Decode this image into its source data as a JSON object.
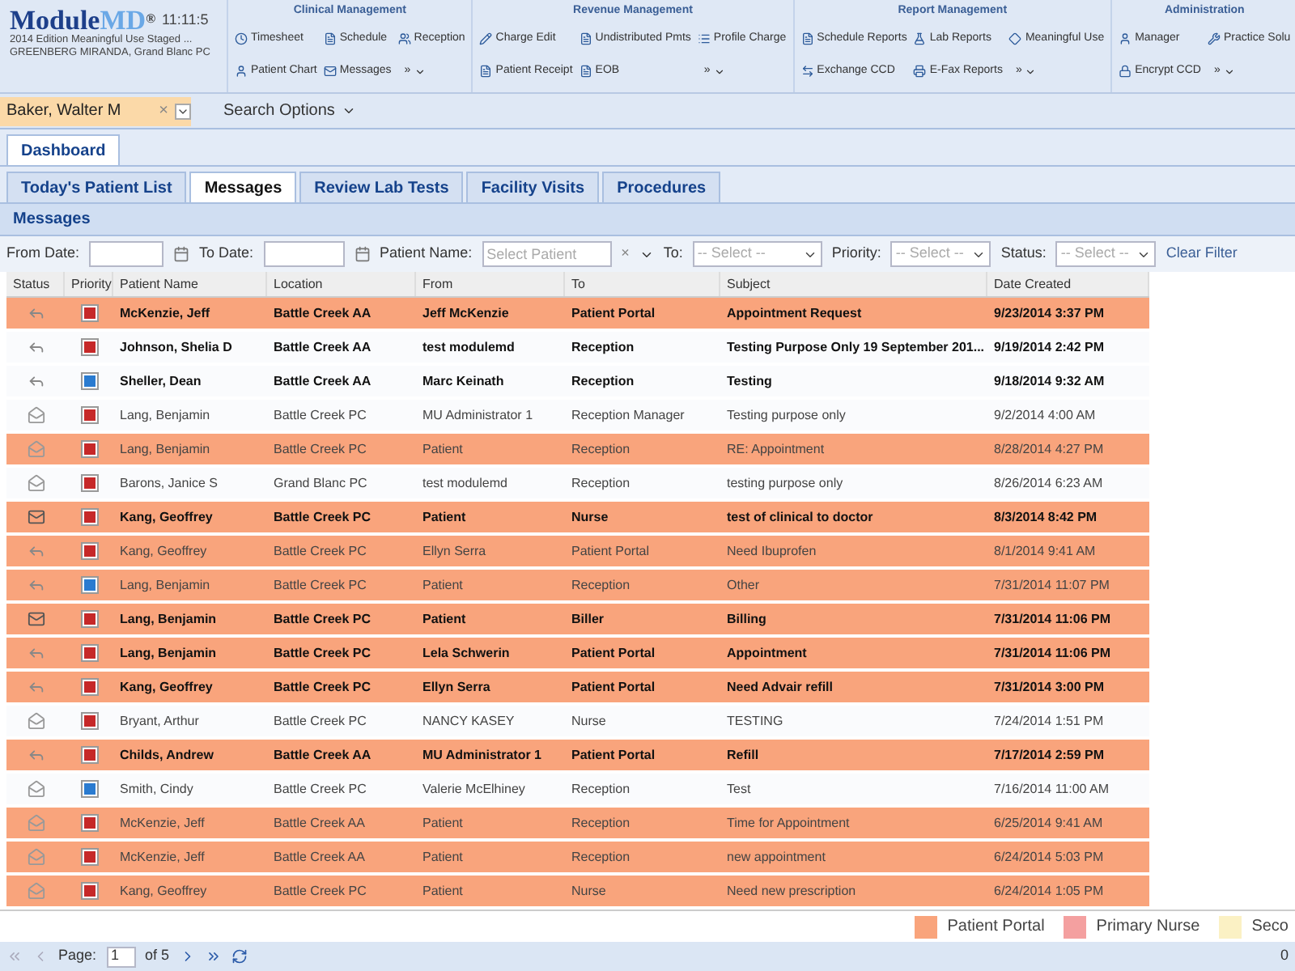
{
  "header": {
    "logo": "Module",
    "logo_accent": "MD",
    "logo_mark": "®",
    "time": "11:11:5",
    "edition": "2014 Edition Meaningful Use Staged ...",
    "user": "GREENBERG MIRANDA, Grand Blanc PC"
  },
  "ribbon": [
    {
      "title": "Clinical Management",
      "items": [
        {
          "label": "Timesheet",
          "kind": "clock"
        },
        {
          "label": "Schedule",
          "kind": "doc"
        },
        {
          "label": "Reception",
          "kind": "users"
        },
        {
          "label": "Patient Chart",
          "kind": "user"
        },
        {
          "label": "Messages",
          "kind": "mail"
        },
        {
          "label": "»",
          "kind": "more"
        }
      ]
    },
    {
      "title": "Revenue Management",
      "items": [
        {
          "label": "Charge Edit",
          "kind": "edit"
        },
        {
          "label": "Undistributed Pmts",
          "kind": "doc"
        },
        {
          "label": "Profile Charge",
          "kind": "list"
        },
        {
          "label": "Patient Receipt",
          "kind": "doc"
        },
        {
          "label": "EOB",
          "kind": "doc"
        },
        {
          "label": "»",
          "kind": "more"
        }
      ]
    },
    {
      "title": "Report Management",
      "items": [
        {
          "label": "Schedule Reports",
          "kind": "doc"
        },
        {
          "label": "Lab Reports",
          "kind": "flask"
        },
        {
          "label": "Meaningful Use",
          "kind": "diamond"
        },
        {
          "label": "Exchange CCD",
          "kind": "swap"
        },
        {
          "label": "E-Fax Reports",
          "kind": "printer"
        },
        {
          "label": "»",
          "kind": "more"
        }
      ]
    },
    {
      "title": "Administration",
      "items": [
        {
          "label": "Manager",
          "kind": "user"
        },
        {
          "label": "Practice Solu",
          "kind": "wrench"
        },
        {
          "label": "Encrypt CCD",
          "kind": "lock"
        },
        {
          "label": "»",
          "kind": "more"
        }
      ]
    }
  ],
  "patient_search": {
    "value": "Baker, Walter M",
    "clear": "×",
    "options": "Search Options"
  },
  "tabs": [
    {
      "label": "Dashboard",
      "selected": true
    }
  ],
  "subtabs": [
    {
      "label": "Today's Patient List",
      "selected": false
    },
    {
      "label": "Messages",
      "selected": true
    },
    {
      "label": "Review Lab Tests",
      "selected": false
    },
    {
      "label": "Facility Visits",
      "selected": false
    },
    {
      "label": "Procedures",
      "selected": false
    }
  ],
  "panel_title": "Messages",
  "filters": {
    "from_date": "From Date:",
    "to_date": "To Date:",
    "patient_name": "Patient Name:",
    "patient_placeholder": "Select Patient",
    "clear": "×",
    "to": "To:",
    "to_placeholder": "-- Select --",
    "priority": "Priority:",
    "priority_placeholder": "-- Select --",
    "status": "Status:",
    "status_placeholder": "-- Select --",
    "clear_filter": "Clear Filter"
  },
  "table": {
    "columns": {
      "status": "Status",
      "priority": "Priority",
      "patient_name": "Patient Name",
      "location": "Location",
      "from": "From",
      "to": "To",
      "subject": "Subject",
      "date_created": "Date Created"
    },
    "rows": [
      {
        "status": {
          "kind": "replied"
        },
        "priority": {
          "kind": "high"
        },
        "highlighted": true,
        "unread": true,
        "patient_name": "McKenzie, Jeff",
        "location": "Battle Creek AA",
        "from": "Jeff McKenzie",
        "to": "Patient Portal",
        "subject": "Appointment Request",
        "date_created": "9/23/2014 3:37 PM"
      },
      {
        "status": {
          "kind": "replied"
        },
        "priority": {
          "kind": "high"
        },
        "highlighted": false,
        "unread": true,
        "patient_name": "Johnson, Shelia D",
        "location": "Battle Creek AA",
        "from": "test modulemd",
        "to": "Reception",
        "subject": "Testing Purpose Only 19 September 201...",
        "date_created": "9/19/2014 2:42 PM"
      },
      {
        "status": {
          "kind": "replied"
        },
        "priority": {
          "kind": "normal"
        },
        "highlighted": false,
        "unread": true,
        "patient_name": "Sheller, Dean",
        "location": "Battle Creek AA",
        "from": "Marc Keinath",
        "to": "Reception",
        "subject": "Testing",
        "date_created": "9/18/2014 9:32 AM"
      },
      {
        "status": {
          "kind": "read"
        },
        "priority": {
          "kind": "high"
        },
        "highlighted": false,
        "unread": false,
        "patient_name": "Lang, Benjamin",
        "location": "Battle Creek PC",
        "from": "MU Administrator 1",
        "to": "Reception Manager",
        "subject": "Testing purpose only",
        "date_created": "9/2/2014 4:00 AM"
      },
      {
        "status": {
          "kind": "read"
        },
        "priority": {
          "kind": "high"
        },
        "highlighted": true,
        "unread": false,
        "patient_name": "Lang, Benjamin",
        "location": "Battle Creek PC",
        "from": "Patient",
        "to": "Reception",
        "subject": "RE: Appointment",
        "date_created": "8/28/2014 4:27 PM"
      },
      {
        "status": {
          "kind": "read"
        },
        "priority": {
          "kind": "high"
        },
        "highlighted": false,
        "unread": false,
        "patient_name": "Barons, Janice S",
        "location": "Grand Blanc PC",
        "from": "test modulemd",
        "to": "Reception",
        "subject": "testing purpose only",
        "date_created": "8/26/2014 6:23 AM"
      },
      {
        "status": {
          "kind": "new"
        },
        "priority": {
          "kind": "high"
        },
        "highlighted": true,
        "unread": true,
        "patient_name": "Kang, Geoffrey",
        "location": "Battle Creek PC",
        "from": "Patient",
        "to": "Nurse",
        "subject": "test of clinical to doctor",
        "date_created": "8/3/2014 8:42 PM"
      },
      {
        "status": {
          "kind": "replied"
        },
        "priority": {
          "kind": "high"
        },
        "highlighted": true,
        "unread": false,
        "patient_name": "Kang, Geoffrey",
        "location": "Battle Creek PC",
        "from": "Ellyn Serra",
        "to": "Patient Portal",
        "subject": "Need Ibuprofen",
        "date_created": "8/1/2014 9:41 AM"
      },
      {
        "status": {
          "kind": "replied"
        },
        "priority": {
          "kind": "normal"
        },
        "highlighted": true,
        "unread": false,
        "patient_name": "Lang, Benjamin",
        "location": "Battle Creek PC",
        "from": "Patient",
        "to": "Reception",
        "subject": "Other",
        "date_created": "7/31/2014 11:07 PM"
      },
      {
        "status": {
          "kind": "new"
        },
        "priority": {
          "kind": "high"
        },
        "highlighted": true,
        "unread": true,
        "patient_name": "Lang, Benjamin",
        "location": "Battle Creek PC",
        "from": "Patient",
        "to": "Biller",
        "subject": "Billing",
        "date_created": "7/31/2014 11:06 PM"
      },
      {
        "status": {
          "kind": "replied"
        },
        "priority": {
          "kind": "high"
        },
        "highlighted": true,
        "unread": true,
        "patient_name": "Lang, Benjamin",
        "location": "Battle Creek PC",
        "from": "Lela Schwerin",
        "to": "Patient Portal",
        "subject": "Appointment",
        "date_created": "7/31/2014 11:06 PM"
      },
      {
        "status": {
          "kind": "replied"
        },
        "priority": {
          "kind": "high"
        },
        "highlighted": true,
        "unread": true,
        "patient_name": "Kang, Geoffrey",
        "location": "Battle Creek PC",
        "from": "Ellyn Serra",
        "to": "Patient Portal",
        "subject": "Need Advair refill",
        "date_created": "7/31/2014 3:00 PM"
      },
      {
        "status": {
          "kind": "read"
        },
        "priority": {
          "kind": "high"
        },
        "highlighted": false,
        "unread": false,
        "patient_name": "Bryant, Arthur",
        "location": "Battle Creek PC",
        "from": "NANCY KASEY",
        "to": "Nurse",
        "subject": "TESTING",
        "date_created": "7/24/2014 1:51 PM"
      },
      {
        "status": {
          "kind": "replied"
        },
        "priority": {
          "kind": "high"
        },
        "highlighted": true,
        "unread": true,
        "patient_name": "Childs, Andrew",
        "location": "Battle Creek AA",
        "from": "MU Administrator 1",
        "to": "Patient Portal",
        "subject": "Refill",
        "date_created": "7/17/2014 2:59 PM"
      },
      {
        "status": {
          "kind": "read"
        },
        "priority": {
          "kind": "normal"
        },
        "highlighted": false,
        "unread": false,
        "patient_name": "Smith, Cindy",
        "location": "Battle Creek PC",
        "from": "Valerie McElhiney",
        "to": "Reception",
        "subject": "Test",
        "date_created": "7/16/2014 11:00 AM"
      },
      {
        "status": {
          "kind": "read"
        },
        "priority": {
          "kind": "high"
        },
        "highlighted": true,
        "unread": false,
        "patient_name": "McKenzie, Jeff",
        "location": "Battle Creek AA",
        "from": "Patient",
        "to": "Reception",
        "subject": "Time for Appointment",
        "date_created": "6/25/2014 9:41 AM"
      },
      {
        "status": {
          "kind": "read"
        },
        "priority": {
          "kind": "high"
        },
        "highlighted": true,
        "unread": false,
        "patient_name": "McKenzie, Jeff",
        "location": "Battle Creek AA",
        "from": "Patient",
        "to": "Reception",
        "subject": "new appointment",
        "date_created": "6/24/2014 5:03 PM"
      },
      {
        "status": {
          "kind": "read"
        },
        "priority": {
          "kind": "high"
        },
        "highlighted": true,
        "unread": false,
        "patient_name": "Kang, Geoffrey",
        "location": "Battle Creek PC",
        "from": "Patient",
        "to": "Nurse",
        "subject": "Need new prescription",
        "date_created": "6/24/2014 1:05 PM"
      }
    ]
  },
  "legend": [
    {
      "label": "Patient Portal",
      "color": "#f9a47c"
    },
    {
      "label": "Primary Nurse",
      "color": "#f4a0a0"
    },
    {
      "label": "Seco",
      "color": "#fbf1c4"
    }
  ],
  "pager": {
    "label": "Page:",
    "page": "1",
    "of": "of 5",
    "corner": "0"
  }
}
